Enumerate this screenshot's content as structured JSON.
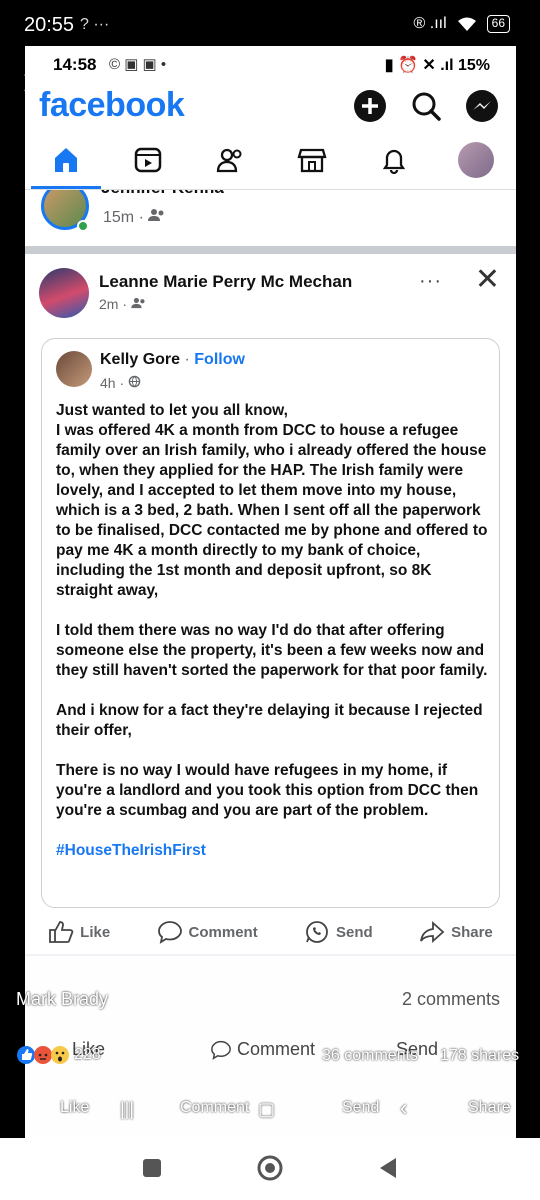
{
  "outer_status": {
    "time": "20:55",
    "left_icons": "? ···",
    "right_icons": "® .ııl",
    "battery": "66"
  },
  "inner_status": {
    "time": "14:58",
    "icons_left": "© ▣ ▣ •",
    "icons_right": "▮ ⏰ ✕ .ıl 15%"
  },
  "app": {
    "logo": "facebook"
  },
  "prev_post": {
    "name": "Jennifer Kenna",
    "time": "15m ·"
  },
  "post": {
    "author": "Leanne Marie Perry Mc Mechan",
    "time": "2m ·",
    "more": "···",
    "shared": {
      "author": "Kelly Gore",
      "follow": "Follow",
      "time": "4h ·",
      "paragraphs": [
        "Just wanted to let you all know,\nI was offered 4K a month from DCC to house a refugee family over an Irish family, who i already offered the house to, when they applied for the HAP. The Irish family were lovely, and I accepted to let them move into my house, which is a 3 bed, 2 bath. When I sent off all the paperwork to be finalised, DCC contacted me by phone and offered to pay me 4K a month directly to my bank of choice, including the 1st month and deposit upfront, so 8K straight away,",
        "I told them there was no way I'd do that after offering someone else the property, it's been a few weeks now and they still haven't sorted the paperwork for that poor family.",
        "And i know for a fact they're delaying it because I rejected their offer,",
        "There is no way I would have refugees in my home, if you're a landlord and you took this option from DCC then you're a scumbag and you are part of the problem."
      ],
      "hashtag": "#HouseTheIrishFirst"
    },
    "actions": {
      "like": "Like",
      "comment": "Comment",
      "send": "Send",
      "share": "Share"
    }
  },
  "overlay": {
    "name": "Mark Brady",
    "comments": "2 comments",
    "like": "Like",
    "comment": "Comment",
    "send": "Send",
    "reactions_count": "228",
    "comments_count": "36 comments",
    "shares_count": "178 shares",
    "row_like": "Like",
    "row_comment": "Comment",
    "row_send": "Send",
    "row_share": "Share"
  }
}
